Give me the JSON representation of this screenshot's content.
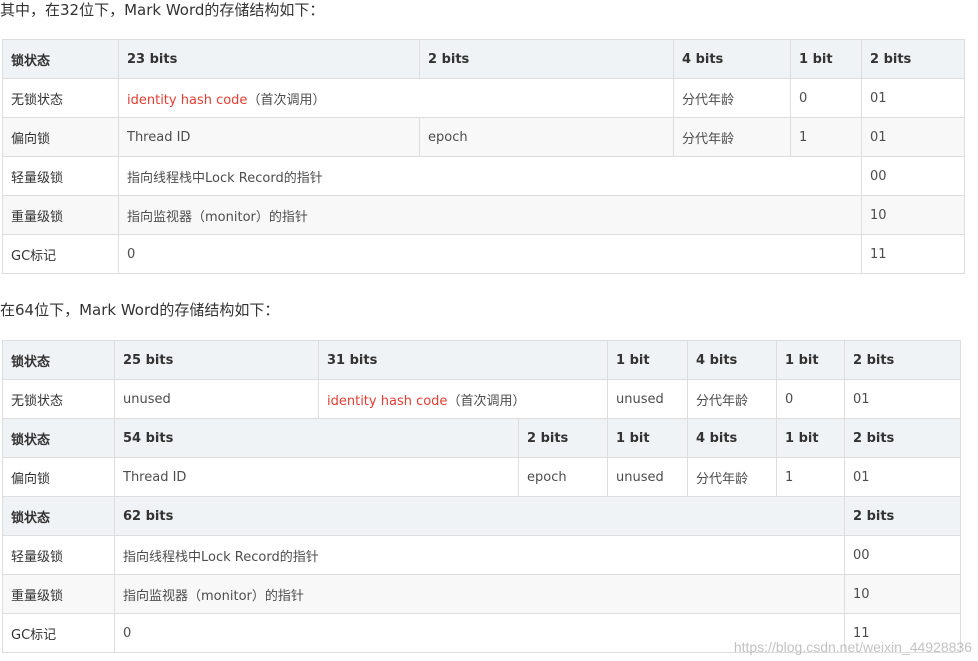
{
  "heading32": "其中，在32位下，Mark Word的存储结构如下：",
  "table32": {
    "header": [
      "锁状态",
      "23 bits",
      "2 bits",
      "4 bits",
      "1 bit",
      "2 bits"
    ],
    "rows": [
      {
        "state": "无锁状态",
        "hash_red": "identity hash code",
        "hash_note": "（首次调用）",
        "age": "分代年龄",
        "bias": "0",
        "flag": "01"
      },
      {
        "state": "偏向锁",
        "thread": "Thread ID",
        "epoch": "epoch",
        "age": "分代年龄",
        "bias": "1",
        "flag": "01"
      },
      {
        "state": "轻量级锁",
        "content": "指向线程栈中Lock Record的指针",
        "flag": "00"
      },
      {
        "state": "重量级锁",
        "content": "指向监视器（monitor）的指针",
        "flag": "10"
      },
      {
        "state": "GC标记",
        "content": "0",
        "flag": "11"
      }
    ]
  },
  "heading64": "在64位下，Mark Word的存储结构如下：",
  "table64": {
    "header1": [
      "锁状态",
      "25 bits",
      "31 bits",
      "1 bit",
      "4 bits",
      "1 bit",
      "2 bits"
    ],
    "row_unlocked": {
      "state": "无锁状态",
      "unused1": "unused",
      "hash_red": "identity hash code",
      "hash_note": "（首次调用）",
      "unused2": "unused",
      "age": "分代年龄",
      "bias": "0",
      "flag": "01"
    },
    "header2": [
      "锁状态",
      "54 bits",
      "2 bits",
      "1 bit",
      "4 bits",
      "1 bit",
      "2 bits"
    ],
    "row_biased": {
      "state": "偏向锁",
      "thread": "Thread ID",
      "epoch": "epoch",
      "unused": "unused",
      "age": "分代年龄",
      "bias": "1",
      "flag": "01"
    },
    "header3": [
      "锁状态",
      "62 bits",
      "2 bits"
    ],
    "rows": [
      {
        "state": "轻量级锁",
        "content": "指向线程栈中Lock Record的指针",
        "flag": "00"
      },
      {
        "state": "重量级锁",
        "content": "指向监视器（monitor）的指针",
        "flag": "10"
      },
      {
        "state": "GC标记",
        "content": "0",
        "flag": "11"
      }
    ]
  },
  "watermark": "https://blog.csdn.net/weixin_44928836",
  "colors": {
    "header_bg": "#eff3f5",
    "alt_bg": "#f8f8f8",
    "border": "#dddddd",
    "hash_red": "#e33e33"
  }
}
